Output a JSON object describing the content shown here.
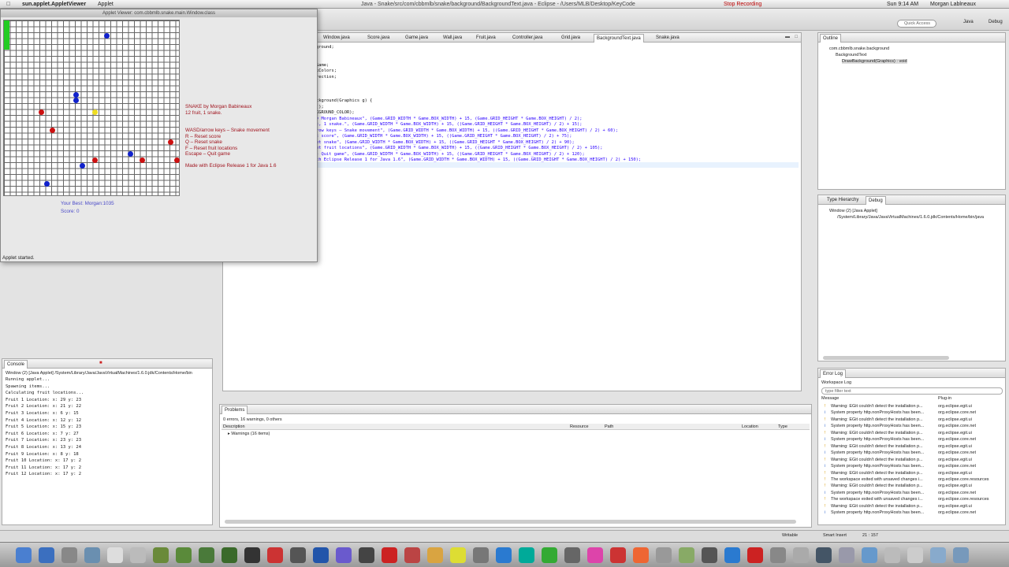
{
  "menubar": {
    "app": "sun.applet.AppletViewer",
    "menu": "Applet",
    "window_title": "Java - Snake/src/com/cbbmlb/snake/background/BackgroundText.java - Eclipse - /Users/MLB/Desktop/KeyCode",
    "recording": "Stop Recording",
    "clock": "Sun 9:14 AM",
    "user": "Morgan Lablneaux"
  },
  "toolbar": {
    "quick_access_placeholder": "Quick Access",
    "perspective_java": "Java",
    "perspective_debug": "Debug"
  },
  "applet": {
    "title": "Applet Viewer: com.cbbmlb.snake.main.Window.class",
    "status": "Applet started.",
    "best": "Your Best: Morgan:1035",
    "score": "Score: 0",
    "info": [
      "SNAKE by Morgan Babineaux",
      "12 fruit, 1 snake.",
      "WASD/arrow keys – Snake movement",
      "R – Reset score",
      "Q – Reset snake",
      "F – Reset fruit locations",
      "Escape – Quit game",
      "Made with Eclipse Release 1 for Java 1.6"
    ],
    "colors": {
      "snake": "#22cc22",
      "blue": "#1122cc",
      "red": "#cc1111",
      "yellow": "#eedd22",
      "text": "#a0141e"
    }
  },
  "editor": {
    "tabs": [
      "Window.java",
      "Score.java",
      "Game.java",
      "Wall.java",
      "Fruit.java",
      "Controller.java",
      "Grid.java",
      "BackgroundText.java",
      "Snake.java"
    ],
    "active_tab": "BackgroundText.java",
    "lines": [
      "ground;",
      "",
      "",
      "Game;",
      "kColors;",
      "rection;",
      "",
      "",
      "",
      "ckground(Graphics g) {",
      "();",
      "KGROUND_COLOR);",
      "y Morgan Babineaux\", (Game.GRID_WIDTH * Game.BOX_WIDTH) + 15, (Game.GRID_HEIGHT * Game.BOX_HEIGHT) / 2);",
      "t, 1 snake.\", (Game.GRID_WIDTH * Game.BOX_WIDTH) + 15, ((Game.GRID_HEIGHT * Game.BOX_HEIGHT) / 2) + 15);",
      "row keys – Snake movement\", (Game.GRID_WIDTH * Game.BOX_WIDTH) + 15, ((Game.GRID_HEIGHT * Game.BOX_HEIGHT) / 2) + 60);",
      "t score\", (Game.GRID_WIDTH * Game.BOX_WIDTH) + 15, ((Game.GRID_HEIGHT * Game.BOX_HEIGHT) / 2) + 75);",
      "et snake\", (Game.GRID_WIDTH * Game.BOX_WIDTH) + 15, ((Game.GRID_HEIGHT * Game.BOX_HEIGHT) / 2) + 90);",
      "et fruit locations\", (Game.GRID_WIDTH * Game.BOX_WIDTH) + 15, ((Game.GRID_HEIGHT * Game.BOX_HEIGHT) / 2) + 105);",
      "- Quit game\", (Game.GRID_WIDTH * Game.BOX_WIDTH) + 15, ((Game.GRID_HEIGHT * Game.BOX_HEIGHT) / 2) + 120);",
      "th Eclipse Release 1 for Java 1.6\", (Game.GRID_WIDTH * Game.BOX_WIDTH) + 15, ((Game.GRID_HEIGHT * Game.BOX_HEIGHT) / 2) + 150);"
    ]
  },
  "outline": {
    "tab": "Outline",
    "items": [
      "com.cbbmlb.snake.background",
      "BackgroundText",
      "DrawBackground(Graphics) : void"
    ]
  },
  "debug": {
    "tab_hierarchy": "Type Hierarchy",
    "tab_debug": "Debug",
    "items": [
      "Window (2) [Java Applet]",
      "/System/Library/Java/JavaVirtualMachines/1.6.0.jdk/Contents/Home/bin/java"
    ]
  },
  "errorlog": {
    "tab": "Error Log",
    "workspace": "Workspace Log",
    "filter_placeholder": "type filter text",
    "col_message": "Message",
    "col_plugin": "Plug-in",
    "rows": [
      {
        "m": "Warning: EGit couldn't detect the installation p...",
        "p": "org.eclipse.egit.ui"
      },
      {
        "m": "System property http.nonProxyHosts has been...",
        "p": "org.eclipse.core.net"
      },
      {
        "m": "Warning: EGit couldn't detect the installation p...",
        "p": "org.eclipse.egit.ui"
      },
      {
        "m": "System property http.nonProxyHosts has been...",
        "p": "org.eclipse.core.net"
      },
      {
        "m": "Warning: EGit couldn't detect the installation p...",
        "p": "org.eclipse.egit.ui"
      },
      {
        "m": "System property http.nonProxyHosts has been...",
        "p": "org.eclipse.core.net"
      },
      {
        "m": "Warning: EGit couldn't detect the installation p...",
        "p": "org.eclipse.egit.ui"
      },
      {
        "m": "System property http.nonProxyHosts has been...",
        "p": "org.eclipse.core.net"
      },
      {
        "m": "Warning: EGit couldn't detect the installation p...",
        "p": "org.eclipse.egit.ui"
      },
      {
        "m": "System property http.nonProxyHosts has been...",
        "p": "org.eclipse.core.net"
      },
      {
        "m": "Warning: EGit couldn't detect the installation p...",
        "p": "org.eclipse.egit.ui"
      },
      {
        "m": "The workspace exited with unsaved changes i...",
        "p": "org.eclipse.core.resources"
      },
      {
        "m": "Warning: EGit couldn't detect the installation p...",
        "p": "org.eclipse.egit.ui"
      },
      {
        "m": "System property http.nonProxyHosts has been...",
        "p": "org.eclipse.core.net"
      },
      {
        "m": "The workspace exited with unsaved changes i...",
        "p": "org.eclipse.core.resources"
      },
      {
        "m": "Warning: EGit couldn't detect the installation p...",
        "p": "org.eclipse.egit.ui"
      },
      {
        "m": "System property http.nonProxyHosts has been...",
        "p": "org.eclipse.core.net"
      }
    ]
  },
  "problems": {
    "tab": "Problems",
    "summary": "0 errors, 16 warnings, 0 others",
    "col_description": "Description",
    "col_resource": "Resource",
    "col_path": "Path",
    "col_location": "Location",
    "col_type": "Type",
    "warnings": "Warnings (16 items)"
  },
  "console": {
    "tab": "Console",
    "header": "Window (2) [Java Applet] /System/Library/Java/JavaVirtualMachines/1.6.0.jdk/Contents/Home/bin",
    "lines": [
      "Running applet...",
      "Spawning items...",
      "Calculating fruit locations...",
      "Fruit 1 Location: x: 29 y: 23",
      "Fruit 2 Location: x: 21 y: 22",
      "Fruit 3 Location: x: 6 y: 15",
      "Fruit 4 Location: x: 12 y: 12",
      "Fruit 5 Location: x: 15 y: 23",
      "Fruit 6 Location: x: 7 y: 27",
      "Fruit 7 Location: x: 23 y: 23",
      "Fruit 8 Location: x: 13 y: 24",
      "Fruit 9 Location: x: 8 y: 18",
      "Fruit 10 Location: x: 17 y: 2",
      "Fruit 11 Location: x: 17 y: 2",
      "Fruit 12 Location: x: 17 y: 2"
    ]
  },
  "statusbar": {
    "mode": "Writable",
    "insert": "Smart Insert",
    "position": "21 : 157"
  }
}
